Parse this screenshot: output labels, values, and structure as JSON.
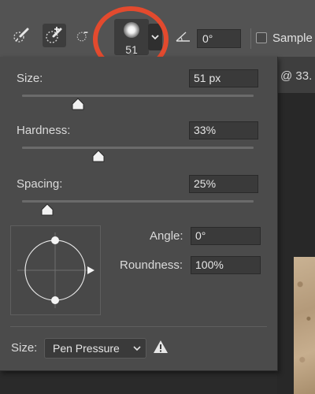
{
  "options_bar": {
    "brush_size_display": "51",
    "angle_value": "0°",
    "sample_label": "Sample"
  },
  "document": {
    "tab_text": "@ 33.",
    "highlight_color": "#e34a2e"
  },
  "brush_panel": {
    "size": {
      "label": "Size:",
      "value": "51 px",
      "slider_fraction": 0.24
    },
    "hardness": {
      "label": "Hardness:",
      "value": "33%",
      "slider_fraction": 0.33
    },
    "spacing": {
      "label": "Spacing:",
      "value": "25%",
      "slider_fraction": 0.11
    },
    "angle": {
      "label": "Angle:",
      "value": "0°"
    },
    "roundness": {
      "label": "Roundness:",
      "value": "100%"
    },
    "dynamics": {
      "label": "Size:",
      "selected": "Pen Pressure"
    }
  },
  "icons": [
    "brush-tool-icon",
    "new-brush-icon",
    "brush-settings-icon",
    "chevron-down-icon",
    "angle-icon",
    "warning-icon"
  ]
}
